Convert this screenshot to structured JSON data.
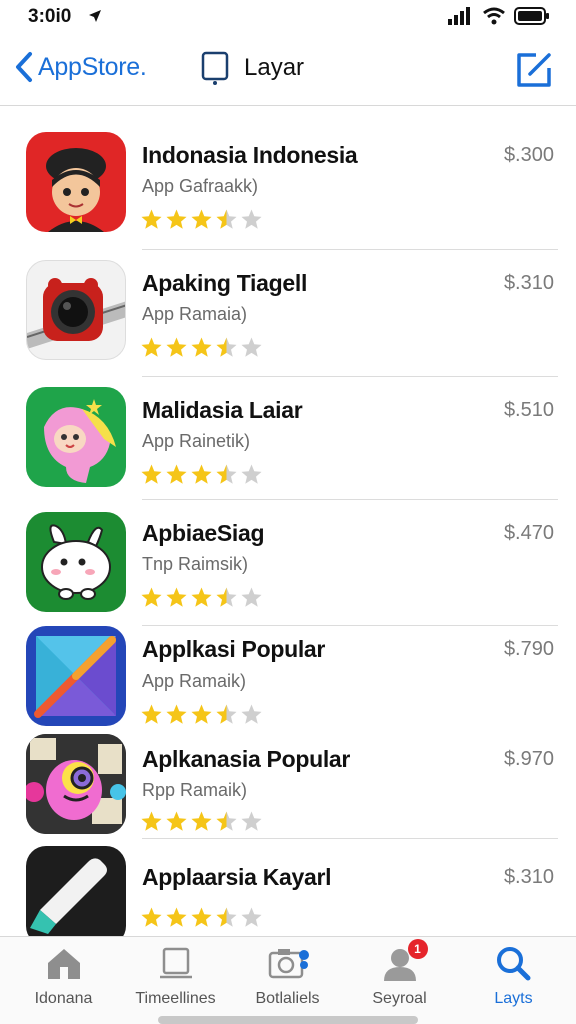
{
  "status_bar": {
    "time": "3:0i0"
  },
  "nav": {
    "back_label": "AppStore.",
    "title": "Layar"
  },
  "apps": [
    {
      "name": "Indonasia Indonesia",
      "subtitle": "App Gafraakk)",
      "price": "$.300",
      "rating": 3.5
    },
    {
      "name": "Apaking Tiagell",
      "subtitle": "App Ramaia)",
      "price": "$.310",
      "rating": 3.5
    },
    {
      "name": "Malidasia Laiar",
      "subtitle": "App Rainetik)",
      "price": "$.510",
      "rating": 3.5
    },
    {
      "name": "ApbiaeSiag",
      "subtitle": "Tnp Raimsik)",
      "price": "$.470",
      "rating": 3.5
    },
    {
      "name": "Applkasi Popular",
      "subtitle": "App Ramaik)",
      "price": "$.790",
      "rating": 3.5
    },
    {
      "name": "Aplkanasia Popular",
      "subtitle": "Rpp Ramaik)",
      "price": "$.970",
      "rating": 3.5
    },
    {
      "name": "Applaarsia Kayarl",
      "subtitle": "",
      "price": "$.310",
      "rating": 3.5
    }
  ],
  "tabs": [
    {
      "label": "Idonana",
      "icon": "home-icon",
      "active": false
    },
    {
      "label": "Timeellines",
      "icon": "timeline-icon",
      "active": false
    },
    {
      "label": "Botlaliels",
      "icon": "camera-icon",
      "active": false
    },
    {
      "label": "Seyroal",
      "icon": "profile-icon",
      "active": false,
      "badge": "1"
    },
    {
      "label": "Layts",
      "icon": "search-icon",
      "active": true
    }
  ],
  "colors": {
    "accent": "#1a6fd8",
    "star": "#f5c518",
    "star_empty": "#cfcfcf",
    "badge": "#e5242b"
  }
}
